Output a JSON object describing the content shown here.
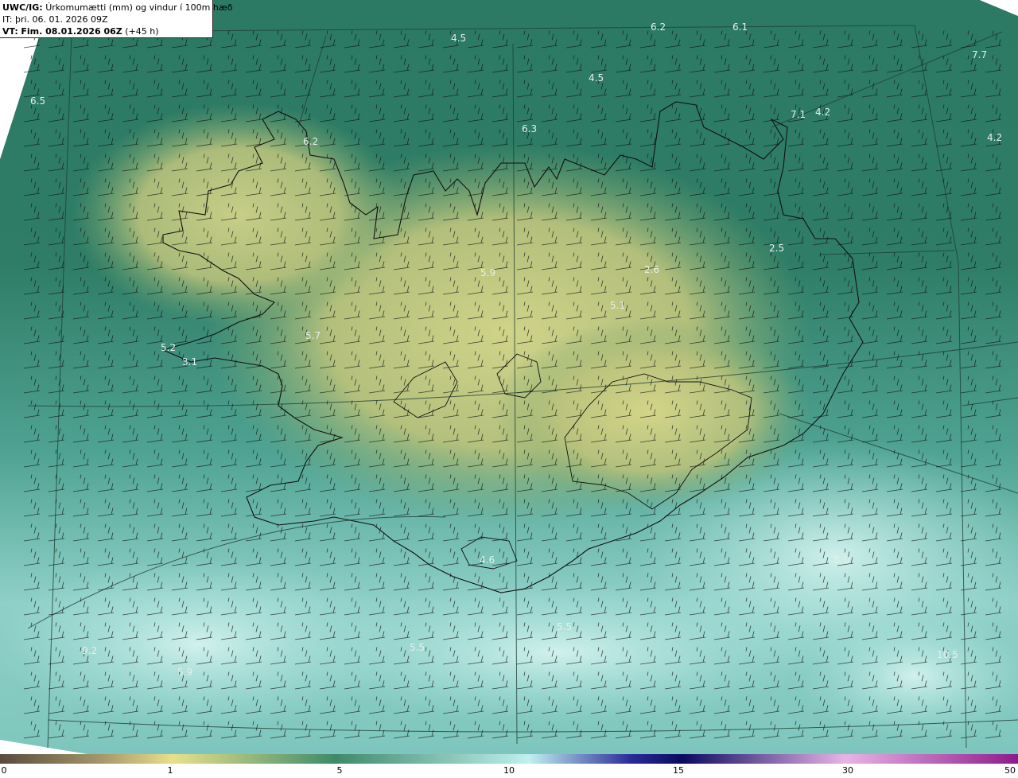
{
  "header": {
    "model_code": "UWC/IG:",
    "title": "Úrkomumætti (mm) og vindur í 100m hæð",
    "init_prefix": "IT:",
    "init_time": "þri. 06. 01. 2026 09Z",
    "valid_prefix": "VT:",
    "valid_time": "Fim. 08.01.2026 06Z",
    "lead_time": "(+45 h)"
  },
  "map": {
    "region": "Iceland",
    "field": "precipitable water (mm)",
    "barb_color": "#111111",
    "coastline_color": "#101010",
    "value_labels": [
      "4.5",
      "6.2",
      "6.1",
      "7.7",
      "6.5",
      "4.5",
      "6.3",
      "7.1",
      "4.2",
      "4.2",
      "6.2",
      "2.5",
      "5.9",
      "2.6",
      "5.1",
      "5.7",
      "5.2",
      "3.1",
      "4.6",
      "5.0",
      "5.5",
      "5.5",
      "9.2",
      "5.9",
      "10.5"
    ]
  },
  "colorbar": {
    "colors": [
      "#5b4a3e",
      "#a6986a",
      "#e8e08a",
      "#3d8a6a",
      "#bff0ee",
      "#2a2a9a",
      "#0a0a60",
      "#e9b4e6",
      "#8c1a8a"
    ],
    "tick_labels": [
      "0",
      "1",
      "5",
      "10",
      "15",
      "30",
      "50"
    ]
  }
}
